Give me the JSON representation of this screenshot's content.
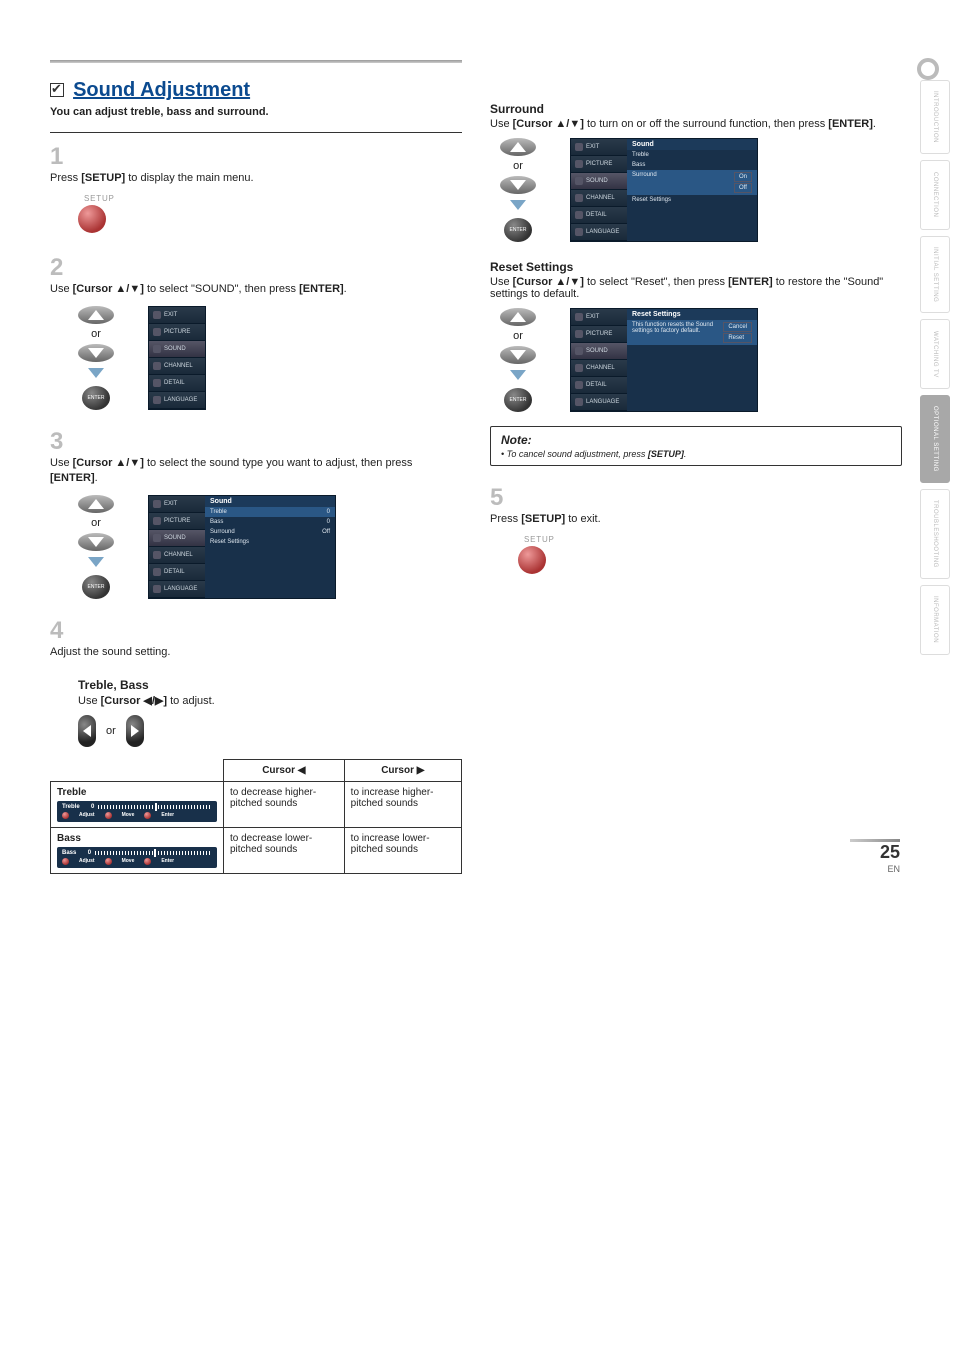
{
  "page": {
    "number": "25",
    "lang": "EN"
  },
  "sideTabs": [
    "INTRODUCTION",
    "CONNECTION",
    "INITIAL SETTING",
    "WATCHING TV",
    "OPTIONAL SETTING",
    "TROUBLESHOOTING",
    "INFORMATION"
  ],
  "title": "Sound Adjustment",
  "subtitle": "You can adjust treble, bass and surround.",
  "steps": {
    "s1": {
      "num": "1",
      "pre": "Press ",
      "key": "[SETUP]",
      "post": " to display the main menu.",
      "label": "SETUP"
    },
    "s2": {
      "num": "2",
      "pre": "Use ",
      "key": "[Cursor ▲/▼]",
      "mid": " to select \"SOUND\", then press ",
      "key2": "[ENTER]",
      "post": "."
    },
    "s3": {
      "num": "3",
      "pre": "Use ",
      "key": "[Cursor ▲/▼]",
      "mid": " to select the sound type you want to adjust, then press ",
      "key2": "[ENTER]",
      "post": "."
    },
    "s4": {
      "num": "4",
      "text": "Adjust the sound setting."
    },
    "s5": {
      "num": "5",
      "pre": "Press ",
      "key": "[SETUP]",
      "post": " to exit.",
      "label": "SETUP"
    }
  },
  "or": "or",
  "enter": "ENTER",
  "osdSide": {
    "exit": "EXIT",
    "picture": "PICTURE",
    "sound": "SOUND",
    "channel": "CHANNEL",
    "detail": "DETAIL",
    "language": "LANGUAGE"
  },
  "osdSound": {
    "head": "Sound",
    "treble": "Treble",
    "trebleVal": "0",
    "bass": "Bass",
    "bassVal": "0",
    "surround": "Surround",
    "surroundVal": "Off",
    "reset": "Reset Settings"
  },
  "trebleBass": {
    "head": "Treble, Bass",
    "pre": "Use ",
    "key": "[Cursor ◀/▶]",
    "post": " to adjust."
  },
  "tbl": {
    "hLeft": "Cursor ◀",
    "hRight": "Cursor ▶",
    "trebleLabel": "Treble",
    "trebleLeft": "to decrease higher-pitched sounds",
    "trebleRight": "to increase higher-pitched sounds",
    "bassLabel": "Bass",
    "bassLeft": "to decrease lower-pitched sounds",
    "bassRight": "to increase lower-pitched sounds",
    "slider": {
      "name1": "Treble",
      "name2": "Bass",
      "zero": "0",
      "adjust": "Adjust",
      "move": "Move",
      "enter": "Enter"
    }
  },
  "surround": {
    "head": "Surround",
    "pre": "Use ",
    "key": "[Cursor ▲/▼]",
    "mid": " to turn on or off the surround function, then press ",
    "key2": "[ENTER]",
    "post": ".",
    "on": "On",
    "off": "Off"
  },
  "reset": {
    "head": "Reset Settings",
    "pre": "Use ",
    "key": "[Cursor ▲/▼]",
    "mid": " to select \"Reset\", then press ",
    "key2": "[ENTER]",
    "post": " to restore the \"Sound\" settings to default.",
    "panelHead": "Reset Settings",
    "line": "This function resets the Sound settings to factory default.",
    "cancel": "Cancel",
    "resetBtn": "Reset"
  },
  "note": {
    "title": "Note:",
    "body": "• To cancel sound adjustment, press ",
    "key": "[SETUP]",
    "post": "."
  }
}
